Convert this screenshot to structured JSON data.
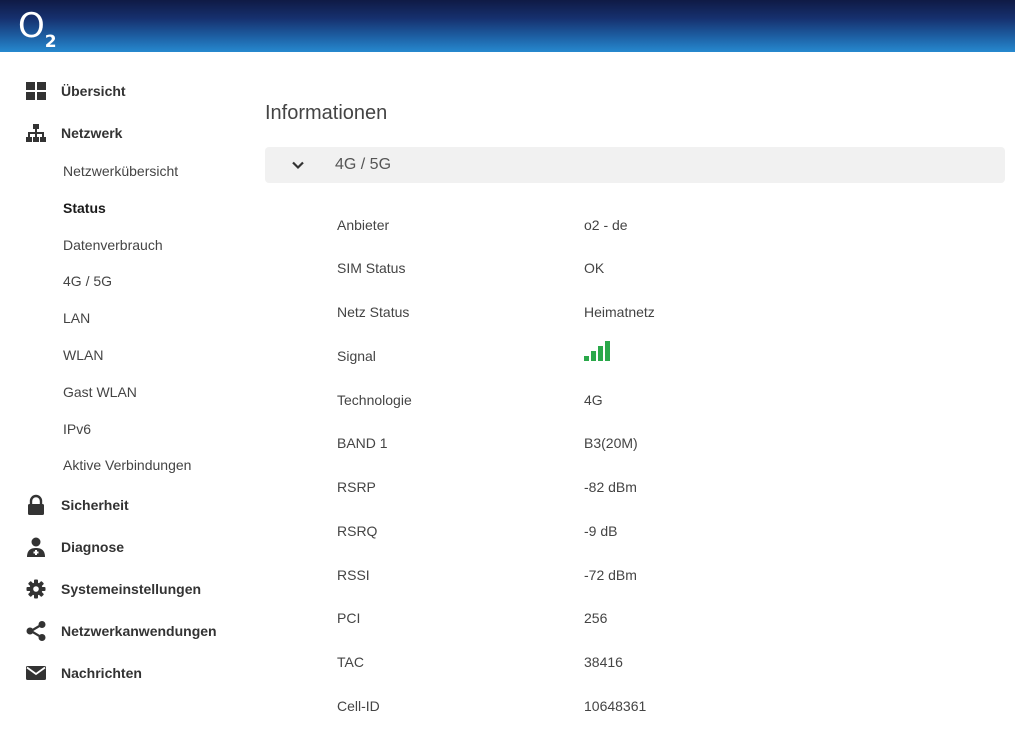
{
  "header": {
    "logo_main": "O",
    "logo_sub": "2"
  },
  "sidebar": {
    "items": [
      {
        "label": "Übersicht",
        "icon": "grid-icon"
      },
      {
        "label": "Netzwerk",
        "icon": "network-icon"
      },
      {
        "label": "Sicherheit",
        "icon": "lock-icon"
      },
      {
        "label": "Diagnose",
        "icon": "doctor-icon"
      },
      {
        "label": "Systemeinstellungen",
        "icon": "gear-icon"
      },
      {
        "label": "Netzwerkanwendungen",
        "icon": "share-icon"
      },
      {
        "label": "Nachrichten",
        "icon": "envelope-icon"
      }
    ],
    "network_sub": [
      {
        "label": "Netzwerkübersicht"
      },
      {
        "label": "Status",
        "active": true
      },
      {
        "label": "Datenverbrauch"
      },
      {
        "label": "4G / 5G"
      },
      {
        "label": "LAN"
      },
      {
        "label": "WLAN"
      },
      {
        "label": "Gast WLAN"
      },
      {
        "label": "IPv6"
      },
      {
        "label": "Aktive Verbindungen"
      }
    ]
  },
  "main": {
    "title": "Informationen",
    "section": {
      "label": "4G / 5G",
      "expanded": true,
      "rows": [
        {
          "label": "Anbieter",
          "value": "o2 - de"
        },
        {
          "label": "SIM Status",
          "value": "OK"
        },
        {
          "label": "Netz Status",
          "value": "Heimatnetz"
        },
        {
          "label": "Signal",
          "value": "",
          "signal_bars": 4,
          "signal_max": 4
        },
        {
          "label": "Technologie",
          "value": "4G"
        },
        {
          "label": "BAND 1",
          "value": "B3(20M)"
        },
        {
          "label": "RSRP",
          "value": "-82 dBm"
        },
        {
          "label": "RSRQ",
          "value": "-9 dB"
        },
        {
          "label": "RSSI",
          "value": "-72 dBm"
        },
        {
          "label": "PCI",
          "value": "256"
        },
        {
          "label": "TAC",
          "value": "38416"
        },
        {
          "label": "Cell-ID",
          "value": "10648361"
        }
      ]
    }
  },
  "colors": {
    "signal_green": "#2aa84a",
    "icon_dark": "#333333",
    "header_dark": "#0f1a45",
    "header_light": "#2689cf"
  }
}
